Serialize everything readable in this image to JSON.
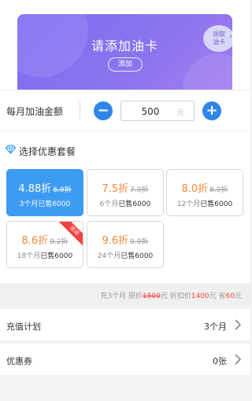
{
  "card": {
    "title": "请添加油卡",
    "add_label": "添加",
    "claim_line1": "领取",
    "claim_line2": "油卡"
  },
  "amount": {
    "label": "每月加油金额",
    "value": "500",
    "unit": "元"
  },
  "packages": {
    "title": "选择优惠套餐",
    "items": [
      {
        "discount": "4.88折",
        "original": "6.9折",
        "months": "3个月",
        "sold": "已售6000",
        "selected": true,
        "badge": ""
      },
      {
        "discount": "7.5折",
        "original": "7.9折",
        "months": "6个月",
        "sold": "已售6000",
        "selected": false,
        "badge": ""
      },
      {
        "discount": "8.0折",
        "original": "8.9折",
        "months": "12个月",
        "sold": "已售6000",
        "selected": false,
        "badge": ""
      },
      {
        "discount": "8.6折",
        "original": "9.2折",
        "months": "18个月",
        "sold": "已售6000",
        "selected": false,
        "badge": "活动"
      },
      {
        "discount": "9.6折",
        "original": "9.9折",
        "months": "24个月",
        "sold": "已售6000",
        "selected": false,
        "badge": ""
      }
    ]
  },
  "summary": {
    "prefix": "充3个月 原价",
    "original_price": "1500",
    "unit1": "元 折扣价",
    "discount_price": "1400",
    "unit2": "元 省",
    "saving": "60",
    "unit3": "元"
  },
  "plan": {
    "label": "充值计划",
    "value": "3个月"
  },
  "coupon": {
    "label": "优惠券",
    "value": "0张"
  },
  "colors": {
    "primary": "#2f86e8",
    "selected_tile": "#3d9cf2",
    "discount_orange": "#f0893a",
    "accent_red": "#f2423f",
    "card_gradient_start": "#7b6cf4",
    "card_gradient_end": "#a27cf0"
  }
}
